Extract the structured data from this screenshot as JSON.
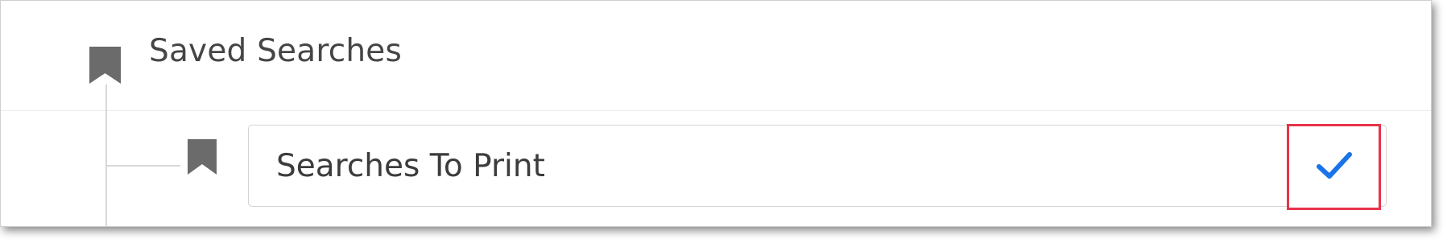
{
  "saved_searches": {
    "root_label": "Saved Searches",
    "root_icon": "bookmark-icon",
    "child": {
      "name_value": "Searches To Print",
      "icon": "bookmark-icon"
    },
    "confirm_icon": "checkmark-icon"
  },
  "colors": {
    "icon_gray": "#6b6b6b",
    "check_blue": "#1a73e8",
    "highlight_red": "#e8334b",
    "tree_line": "#d8d8d8"
  }
}
